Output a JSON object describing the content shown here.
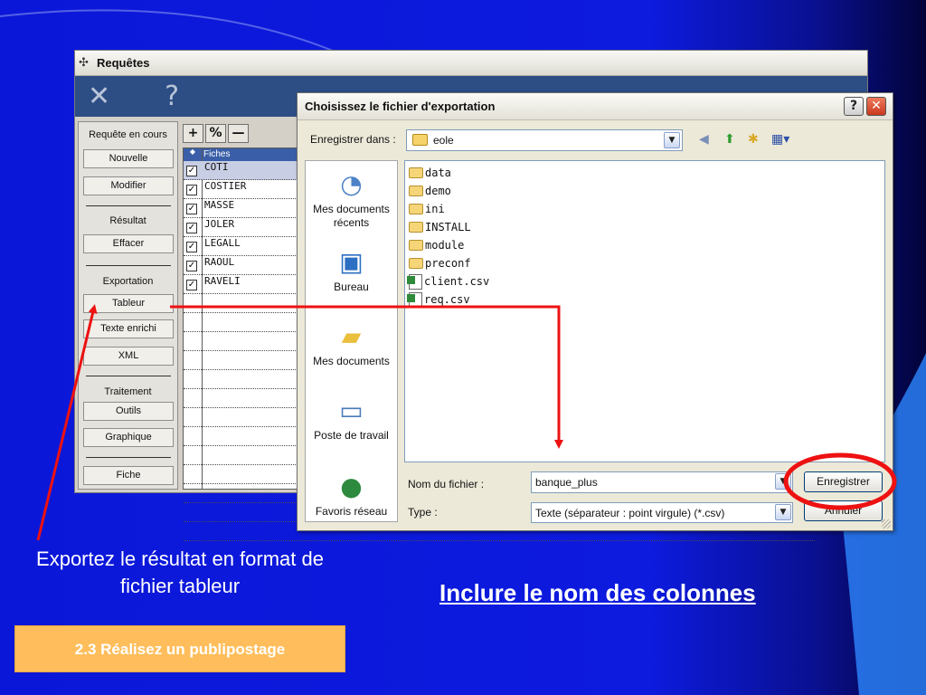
{
  "requetes_window": {
    "title": "Requêtes",
    "title_icon": "pin-icon",
    "toolbar_icons": [
      "tools-icon",
      "help-question-icon"
    ],
    "side_panel": {
      "section_current": "Requête en cours",
      "btn_new": "Nouvelle",
      "btn_modify": "Modifier",
      "section_result": "Résultat",
      "btn_clear": "Effacer",
      "section_export": "Exportation",
      "btn_spreadsheet": "Tableur",
      "btn_rich_text": "Texte enrichi",
      "btn_xml": "XML",
      "section_processing": "Traitement",
      "btn_tools": "Outils",
      "btn_chart": "Graphique",
      "btn_record": "Fiche"
    },
    "grid": {
      "tool_add": "+",
      "tool_percent": "%",
      "tool_remove": "—",
      "column_header": "Fiches",
      "rows": [
        {
          "name": "COTI",
          "checked": true,
          "selected": true
        },
        {
          "name": "COSTIER",
          "checked": true,
          "selected": false
        },
        {
          "name": "MASSE",
          "checked": true,
          "selected": false
        },
        {
          "name": "JOLER",
          "checked": true,
          "selected": false
        },
        {
          "name": "LEGALL",
          "checked": true,
          "selected": false
        },
        {
          "name": "RAOUL",
          "checked": true,
          "selected": false
        },
        {
          "name": "RAVELI",
          "checked": true,
          "selected": false
        }
      ]
    }
  },
  "export_dialog": {
    "title": "Choisissez le fichier d'exportation",
    "help_glyph": "?",
    "close_glyph": "✕",
    "save_in_label": "Enregistrer dans :",
    "save_in_value": "eole",
    "places": [
      {
        "label": "Mes documents récents",
        "icon": "recent-documents-icon"
      },
      {
        "label": "Bureau",
        "icon": "desktop-icon"
      },
      {
        "label": "Mes documents",
        "icon": "my-documents-icon"
      },
      {
        "label": "Poste de travail",
        "icon": "my-computer-icon"
      },
      {
        "label": "Favoris réseau",
        "icon": "network-places-icon"
      }
    ],
    "files": [
      {
        "name": "data",
        "kind": "folder"
      },
      {
        "name": "demo",
        "kind": "folder"
      },
      {
        "name": "ini",
        "kind": "folder"
      },
      {
        "name": "INSTALL",
        "kind": "folder"
      },
      {
        "name": "module",
        "kind": "folder"
      },
      {
        "name": "preconf",
        "kind": "folder"
      },
      {
        "name": "client.csv",
        "kind": "csv"
      },
      {
        "name": "req.csv",
        "kind": "csv"
      }
    ],
    "filename_label": "Nom du fichier :",
    "filename_value": "banque_plus",
    "type_label": "Type :",
    "type_value": "Texte (séparateur : point virgule) (*.csv)",
    "save_button": "Enregistrer",
    "cancel_button": "Annuler"
  },
  "annotations": {
    "left_caption": "Exportez le résultat en format de fichier tableur",
    "right_caption": "Inclure le nom des colonnes",
    "section_badge": "2.3 Réalisez un publipostage",
    "arrow_color": "#ee1111",
    "highlight_color": "#ee1111"
  },
  "colors": {
    "slide_background": "#0c18dc",
    "toolbar": "#2d4e84",
    "badge": "#ffbe5b"
  }
}
